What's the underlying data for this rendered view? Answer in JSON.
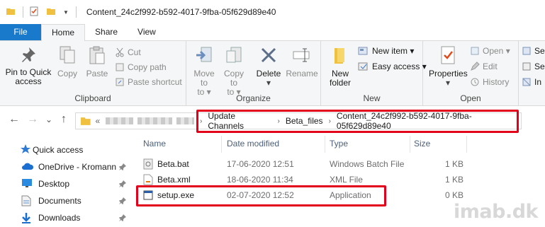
{
  "window": {
    "title": "Content_24c2f992-b592-4017-9fba-05f629d89e40",
    "quick_access_arrow": "▼"
  },
  "tabs": [
    {
      "label": "File"
    },
    {
      "label": "Home"
    },
    {
      "label": "Share"
    },
    {
      "label": "View"
    }
  ],
  "ribbon": {
    "clipboard": {
      "label": "Clipboard",
      "pin_to_quick_access": "Pin to Quick access",
      "copy": "Copy",
      "paste": "Paste",
      "cut": "Cut",
      "copy_path": "Copy path",
      "paste_shortcut": "Paste shortcut"
    },
    "organize": {
      "label": "Organize",
      "move_to": "Move to",
      "copy_to": "Copy to",
      "delete": "Delete",
      "rename": "Rename",
      "move_to_line2": "to ▾",
      "copy_to_line2": "to ▾"
    },
    "new": {
      "label": "New",
      "new_folder": "New folder",
      "new_item": "New item ▾",
      "easy_access": "Easy access ▾"
    },
    "open": {
      "label": "Open",
      "properties": "Properties",
      "open": "Open ▾",
      "edit": "Edit",
      "history": "History"
    },
    "select": {
      "item1": "Se",
      "item2": "Se",
      "item3": "In"
    }
  },
  "address": {
    "prefix": "«",
    "crumbs": [
      "Update Channels",
      "Beta_files",
      "Content_24c2f992-b592-4017-9fba-05f629d89e40"
    ],
    "separator": "›"
  },
  "nav": {
    "back": "←",
    "forward": "→",
    "dropdown": "⌄",
    "up": "↑"
  },
  "navpane": [
    {
      "label": "Quick access",
      "icon": "star-icon"
    },
    {
      "label": "OneDrive - Kromann",
      "icon": "cloud-icon"
    },
    {
      "label": "Desktop",
      "icon": "desktop-icon"
    },
    {
      "label": "Documents",
      "icon": "documents-icon"
    },
    {
      "label": "Downloads",
      "icon": "downloads-icon"
    }
  ],
  "columns": {
    "name": "Name",
    "date": "Date modified",
    "type": "Type",
    "size": "Size"
  },
  "files": [
    {
      "name": "Beta.bat",
      "date": "17-06-2020 12:51",
      "type": "Windows Batch File",
      "size": "1 KB"
    },
    {
      "name": "Beta.xml",
      "date": "18-06-2020 11:34",
      "type": "XML File",
      "size": "1 KB"
    },
    {
      "name": "setup.exe",
      "date": "02-07-2020 12:52",
      "type": "Application",
      "size": "0 KB"
    }
  ],
  "watermark": "imab.dk",
  "colors": {
    "file_tab": "#1979ca",
    "highlight": "#e2001a",
    "folder": "#f0c040"
  }
}
